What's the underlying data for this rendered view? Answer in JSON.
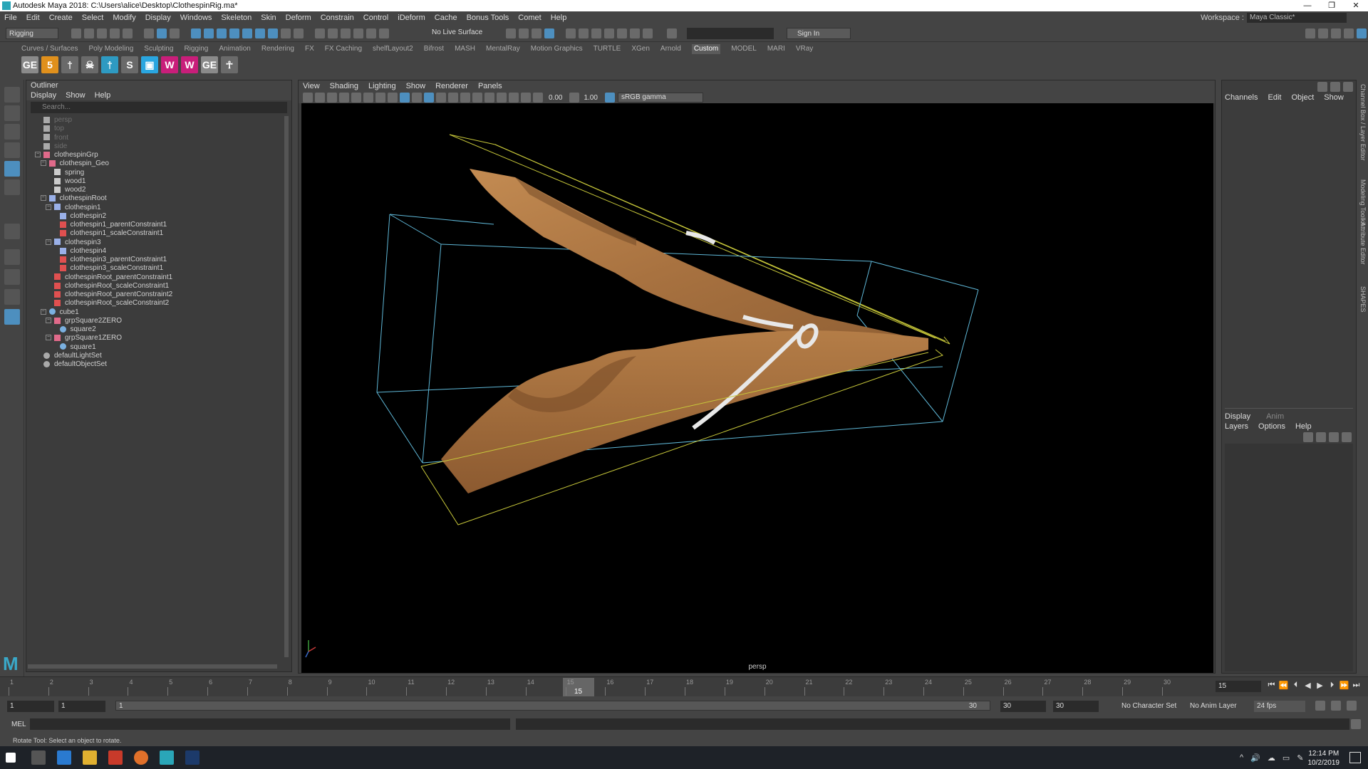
{
  "window": {
    "title": "Autodesk Maya 2018: C:\\Users\\alice\\Desktop\\ClothespinRig.ma*",
    "controls": [
      "—",
      "❐",
      "✕"
    ]
  },
  "menubar": [
    "File",
    "Edit",
    "Create",
    "Select",
    "Modify",
    "Display",
    "Windows",
    "Skeleton",
    "Skin",
    "Deform",
    "Constrain",
    "Control",
    "iDeform",
    "Cache",
    "Bonus Tools",
    "Comet",
    "Help"
  ],
  "workspace": {
    "label": "Workspace :",
    "value": "Maya Classic*"
  },
  "statusline": {
    "mode": "Rigging",
    "live_surface": "No Live Surface",
    "sign_in": "Sign In"
  },
  "shelf": {
    "tabs": [
      "Curves / Surfaces",
      "Poly Modeling",
      "Sculpting",
      "Rigging",
      "Animation",
      "Rendering",
      "FX",
      "FX Caching",
      "shelfLayout2",
      "Bifrost",
      "MASH",
      "MentalRay",
      "Motion Graphics",
      "TURTLE",
      "XGen",
      "Arnold",
      "Custom",
      "MODEL",
      "MARI",
      "VRay"
    ],
    "active_tab": "Custom",
    "icons": [
      {
        "name": "ge-icon",
        "text": "GE",
        "color": "#8a8a8a"
      },
      {
        "name": "five-icon",
        "text": "5",
        "color": "#e0901c"
      },
      {
        "name": "joint-icon",
        "text": "†",
        "color": "#6a6a6a"
      },
      {
        "name": "skull-icon",
        "text": "☠",
        "color": "#6a6a6a"
      },
      {
        "name": "rig-icon",
        "text": "†",
        "color": "#2e9ac2"
      },
      {
        "name": "s-icon",
        "text": "S",
        "color": "#6a6a6a"
      },
      {
        "name": "box-icon",
        "text": "▣",
        "color": "#2aa6e0"
      },
      {
        "name": "export-icon",
        "text": "W",
        "color": "#c81e7a"
      },
      {
        "name": "import-icon",
        "text": "W",
        "color": "#c81e7a"
      },
      {
        "name": "ge2-icon",
        "text": "GE",
        "color": "#8a8a8a"
      },
      {
        "name": "figure-icon",
        "text": "☥",
        "color": "#6a6a6a"
      }
    ]
  },
  "outliner": {
    "title": "Outliner",
    "menu": [
      "Display",
      "Show",
      "Help"
    ],
    "search_placeholder": "Search...",
    "items": [
      {
        "label": "persp",
        "indent": 0,
        "dim": true,
        "type": "camera"
      },
      {
        "label": "top",
        "indent": 0,
        "dim": true,
        "type": "camera"
      },
      {
        "label": "front",
        "indent": 0,
        "dim": true,
        "type": "camera"
      },
      {
        "label": "side",
        "indent": 0,
        "dim": true,
        "type": "camera"
      },
      {
        "label": "clothespinGrp",
        "indent": 0,
        "type": "group",
        "exp": "−"
      },
      {
        "label": "clothespin_Geo",
        "indent": 1,
        "type": "group",
        "exp": "−"
      },
      {
        "label": "spring",
        "indent": 2,
        "type": "mesh"
      },
      {
        "label": "wood1",
        "indent": 2,
        "type": "mesh"
      },
      {
        "label": "wood2",
        "indent": 2,
        "type": "mesh"
      },
      {
        "label": "clothespinRoot",
        "indent": 1,
        "type": "joint",
        "exp": "−"
      },
      {
        "label": "clothespin1",
        "indent": 2,
        "type": "joint",
        "exp": "−"
      },
      {
        "label": "clothespin2",
        "indent": 3,
        "type": "joint"
      },
      {
        "label": "clothespin1_parentConstraint1",
        "indent": 3,
        "type": "constraint"
      },
      {
        "label": "clothespin1_scaleConstraint1",
        "indent": 3,
        "type": "constraint"
      },
      {
        "label": "clothespin3",
        "indent": 2,
        "type": "joint",
        "exp": "−"
      },
      {
        "label": "clothespin4",
        "indent": 3,
        "type": "joint"
      },
      {
        "label": "clothespin3_parentConstraint1",
        "indent": 3,
        "type": "constraint"
      },
      {
        "label": "clothespin3_scaleConstraint1",
        "indent": 3,
        "type": "constraint"
      },
      {
        "label": "clothespinRoot_parentConstraint1",
        "indent": 2,
        "type": "constraint"
      },
      {
        "label": "clothespinRoot_scaleConstraint1",
        "indent": 2,
        "type": "constraint"
      },
      {
        "label": "clothespinRoot_parentConstraint2",
        "indent": 2,
        "type": "constraint"
      },
      {
        "label": "clothespinRoot_scaleConstraint2",
        "indent": 2,
        "type": "constraint"
      },
      {
        "label": "cube1",
        "indent": 1,
        "type": "curve",
        "exp": "−"
      },
      {
        "label": "grpSquare2ZERO",
        "indent": 2,
        "type": "group",
        "exp": "−"
      },
      {
        "label": "square2",
        "indent": 3,
        "type": "curve"
      },
      {
        "label": "grpSquare1ZERO",
        "indent": 2,
        "type": "group",
        "exp": "−"
      },
      {
        "label": "square1",
        "indent": 3,
        "type": "curve"
      },
      {
        "label": "defaultLightSet",
        "indent": 0,
        "type": "set"
      },
      {
        "label": "defaultObjectSet",
        "indent": 0,
        "type": "set"
      }
    ]
  },
  "viewport": {
    "menu": [
      "View",
      "Shading",
      "Lighting",
      "Show",
      "Renderer",
      "Panels"
    ],
    "exposure": "0.00",
    "gamma": "1.00",
    "color_space": "sRGB gamma",
    "camera_label": "persp"
  },
  "channelbox": {
    "menu": [
      "Channels",
      "Edit",
      "Object",
      "Show"
    ]
  },
  "layers": {
    "tabs": [
      "Display",
      "Anim"
    ],
    "menu": [
      "Layers",
      "Options",
      "Help"
    ]
  },
  "side_tabs": [
    "Channel Box / Layer Editor",
    "Modeling Toolkit",
    "Attribute Editor",
    "SHAPES"
  ],
  "timeslider": {
    "ticks": [
      "1",
      "2",
      "3",
      "4",
      "5",
      "6",
      "7",
      "8",
      "9",
      "10",
      "11",
      "12",
      "13",
      "14",
      "15",
      "16",
      "17",
      "18",
      "19",
      "20",
      "21",
      "22",
      "23",
      "24",
      "25",
      "26",
      "27",
      "28",
      "29",
      "30"
    ],
    "current_frame": "15",
    "frame_field": "15"
  },
  "range": {
    "start": "1",
    "anim_start": "1",
    "slider_start": "1",
    "slider_end": "30",
    "end": "30",
    "anim_end": "30",
    "character_set": "No Character Set",
    "anim_layer": "No Anim Layer",
    "fps": "24 fps"
  },
  "cmdline": {
    "label": "MEL"
  },
  "helpline": "Rotate Tool: Select an object to rotate.",
  "taskbar": {
    "time": "12:14 PM",
    "date": "10/2/2019"
  },
  "colors": {
    "accent": "#4d8fbf",
    "wood": "#b07a46",
    "box_cyan": "#5fb8d8",
    "box_yellow": "#c8c83a"
  }
}
